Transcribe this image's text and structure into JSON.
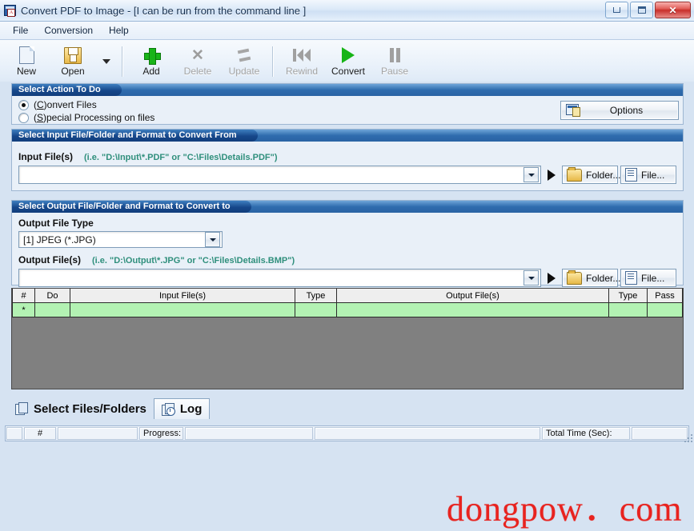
{
  "window": {
    "title": "Convert PDF to Image - [I can be run from the command line ]",
    "app_icon": "pdf-document-icon",
    "controls": {
      "minimize": "minimize-button",
      "maximize": "maximize-button",
      "close": "close-button"
    }
  },
  "menu": {
    "items": [
      {
        "label": "File"
      },
      {
        "label": "Conversion"
      },
      {
        "label": "Help"
      }
    ]
  },
  "toolbar": {
    "buttons": [
      {
        "label": "New",
        "icon": "new-document-icon",
        "enabled": true
      },
      {
        "label": "Open",
        "icon": "open-folder-icon",
        "enabled": true
      },
      {
        "label": "Add",
        "icon": "green-plus-icon",
        "enabled": true
      },
      {
        "label": "Delete",
        "icon": "gray-x-icon",
        "enabled": false
      },
      {
        "label": "Update",
        "icon": "refresh-icon",
        "enabled": false
      },
      {
        "label": "Rewind",
        "icon": "rewind-icon",
        "enabled": false
      },
      {
        "label": "Convert",
        "icon": "green-play-icon",
        "enabled": true
      },
      {
        "label": "Pause",
        "icon": "pause-icon",
        "enabled": false
      }
    ],
    "dropdown_icon": "chevron-down-icon"
  },
  "action_section": {
    "header": "Select Action To Do",
    "radios": [
      {
        "label_prefix": "(",
        "accel": "C",
        "label_suffix": ")onvert Files",
        "selected": true
      },
      {
        "label_prefix": "(",
        "accel": "S",
        "label_suffix": ")pecial Processing on files",
        "selected": false
      }
    ],
    "options_button": {
      "label": "Options",
      "icon": "options-window-icon"
    }
  },
  "input_section": {
    "header": "Select Input File/Folder and Format to Convert From",
    "field_label": "Input File(s)",
    "hint": "(i.e. \"D:\\Input\\*.PDF\"   or \"C:\\Files\\Details.PDF\")",
    "value": "",
    "dropdown_icon": "chevron-down-icon",
    "play_icon": "play-arrow-icon",
    "folder_button": {
      "label": "Folder...",
      "icon": "folder-icon"
    },
    "file_button": {
      "label": "File...",
      "icon": "file-icon"
    }
  },
  "output_section": {
    "header": "Select Output File/Folder and Format to Convert to",
    "type_label": "Output File Type",
    "type_value": "[1] JPEG (*.JPG)",
    "field_label": "Output File(s)",
    "hint": "(i.e. \"D:\\Output\\*.JPG\"   or \"C:\\Files\\Details.BMP\")",
    "value": "",
    "dropdown_icon": "chevron-down-icon",
    "play_icon": "play-arrow-icon",
    "folder_button": {
      "label": "Folder...",
      "icon": "folder-icon"
    },
    "file_button": {
      "label": "File...",
      "icon": "file-icon"
    }
  },
  "grid": {
    "columns": [
      {
        "label": "#"
      },
      {
        "label": "Do"
      },
      {
        "label": "Input File(s)"
      },
      {
        "label": "Type"
      },
      {
        "label": "Output File(s)"
      },
      {
        "label": "Type"
      },
      {
        "label": "Pass"
      }
    ],
    "rows": [
      {
        "marker": "*",
        "do": "",
        "input": "",
        "in_type": "",
        "output": "",
        "out_type": "",
        "pass": ""
      }
    ]
  },
  "tabs": [
    {
      "label": "Select Files/Folders",
      "icon": "files-folders-icon",
      "active": true
    },
    {
      "label": "Log",
      "icon": "log-clock-icon",
      "active": false
    }
  ],
  "statusbar": {
    "count_label": "#",
    "count_value": "",
    "progress_label": "Progress:",
    "progress_value": "",
    "message": "",
    "total_time_label": "Total Time (Sec):",
    "total_time_value": ""
  },
  "watermark": {
    "text": "dongpow．com",
    "color": "#e8231f"
  },
  "colors": {
    "section_header_start": "#3f7fc0",
    "section_header_end": "#123e7c",
    "grid_new_row": "#b3f2b3",
    "grid_body": "#808080",
    "hint_text": "#2f8f7c",
    "accent_green": "#17b417"
  }
}
